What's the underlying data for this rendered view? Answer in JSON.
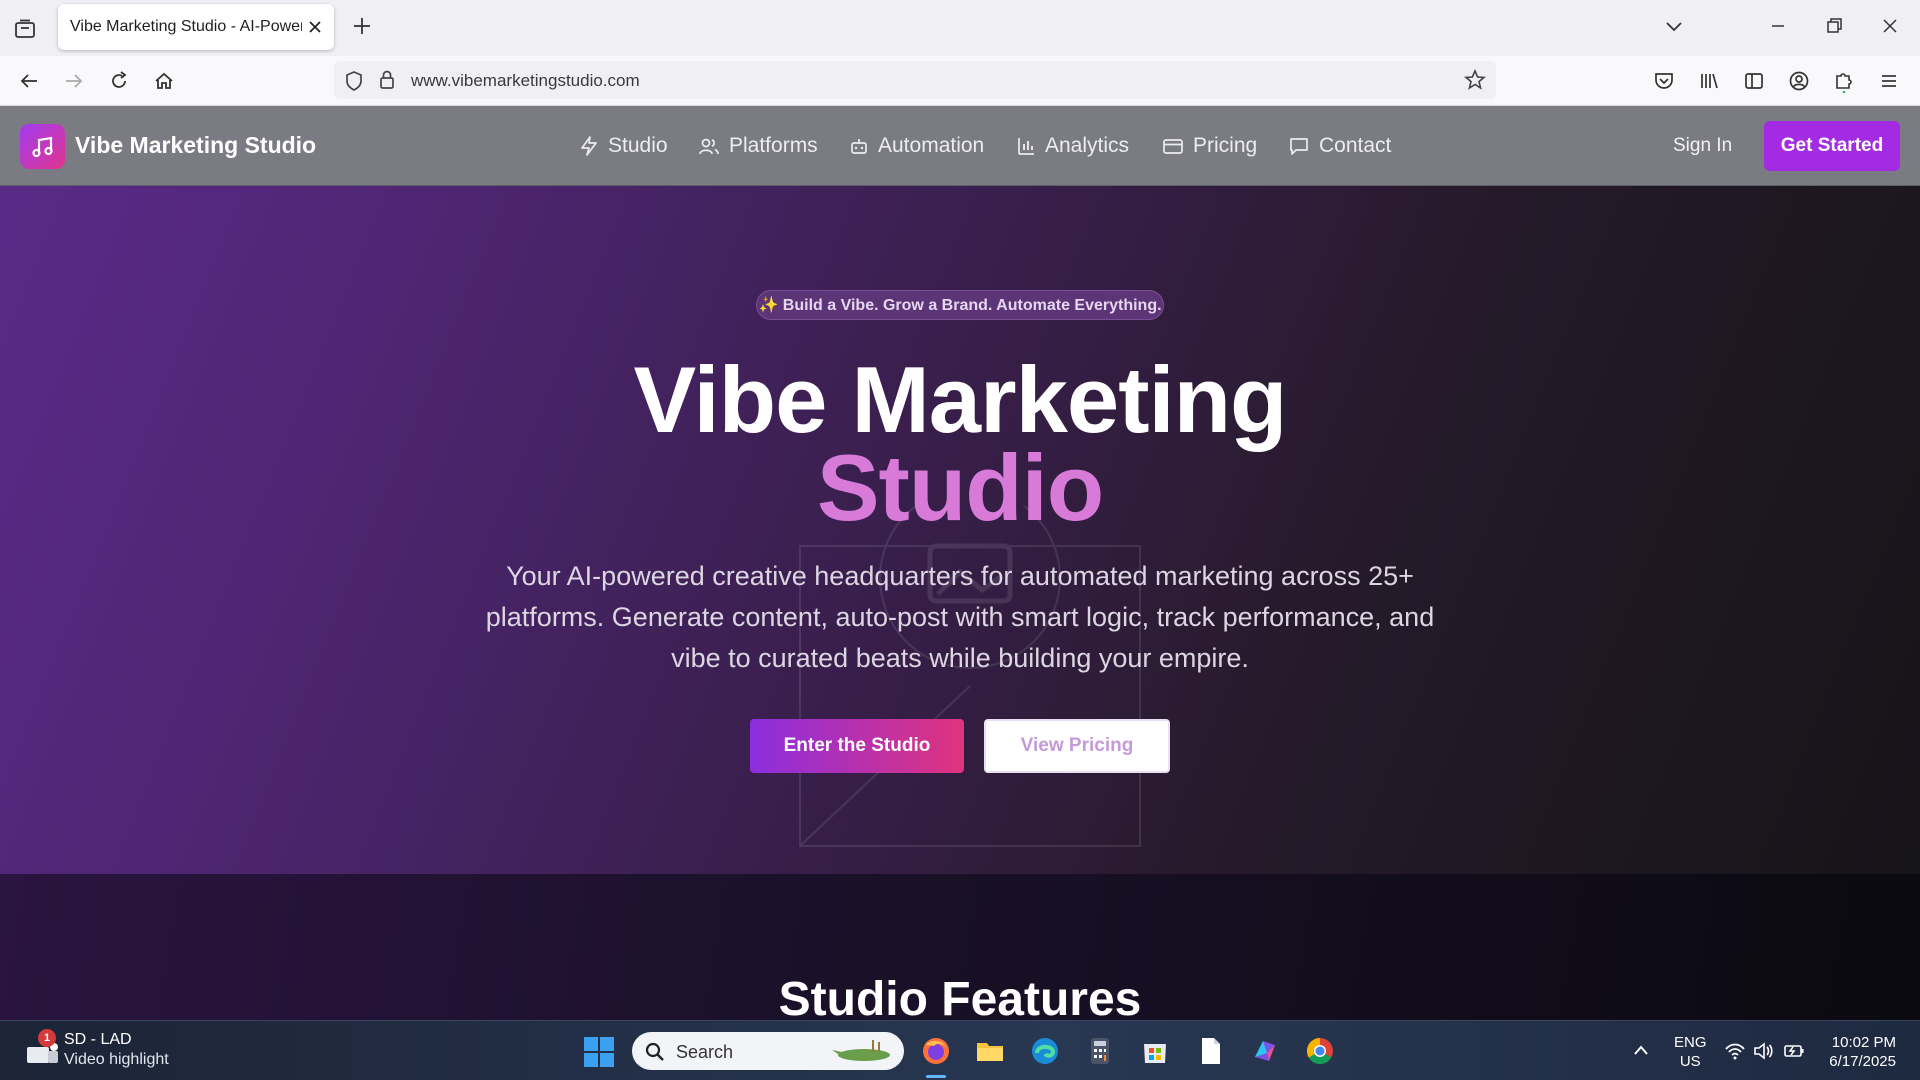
{
  "browser": {
    "tab_title": "Vibe Marketing Studio - AI-Powered",
    "url": "www.vibemarketingstudio.com"
  },
  "site_nav": {
    "brand": "Vibe Marketing Studio",
    "items": [
      {
        "label": "Studio",
        "icon": "lightning-icon"
      },
      {
        "label": "Platforms",
        "icon": "users-icon"
      },
      {
        "label": "Automation",
        "icon": "robot-icon"
      },
      {
        "label": "Analytics",
        "icon": "bar-chart-icon"
      },
      {
        "label": "Pricing",
        "icon": "credit-card-icon"
      },
      {
        "label": "Contact",
        "icon": "message-icon"
      }
    ],
    "sign_in": "Sign In",
    "get_started": "Get Started"
  },
  "hero": {
    "badge": "✨ Build a Vibe. Grow a Brand. Automate Everything.",
    "title_line1": "Vibe Marketing",
    "title_line2": "Studio",
    "description": "Your AI-powered creative headquarters for automated marketing across 25+ platforms. Generate content, auto-post with smart logic, track performance, and vibe to curated beats while building your empire.",
    "primary_cta": "Enter the Studio",
    "secondary_cta": "View Pricing"
  },
  "features": {
    "title": "Studio Features"
  },
  "taskbar": {
    "news_badge": "1",
    "news_title": "SD - LAD",
    "news_subtitle": "Video highlight",
    "search_placeholder": "Search",
    "lang_line1": "ENG",
    "lang_line2": "US",
    "time": "10:02 PM",
    "date": "6/17/2025"
  },
  "colors": {
    "accent_purple": "#a42be4",
    "accent_pink": "#d77ad8",
    "nav_bg": "#7b7b84"
  }
}
